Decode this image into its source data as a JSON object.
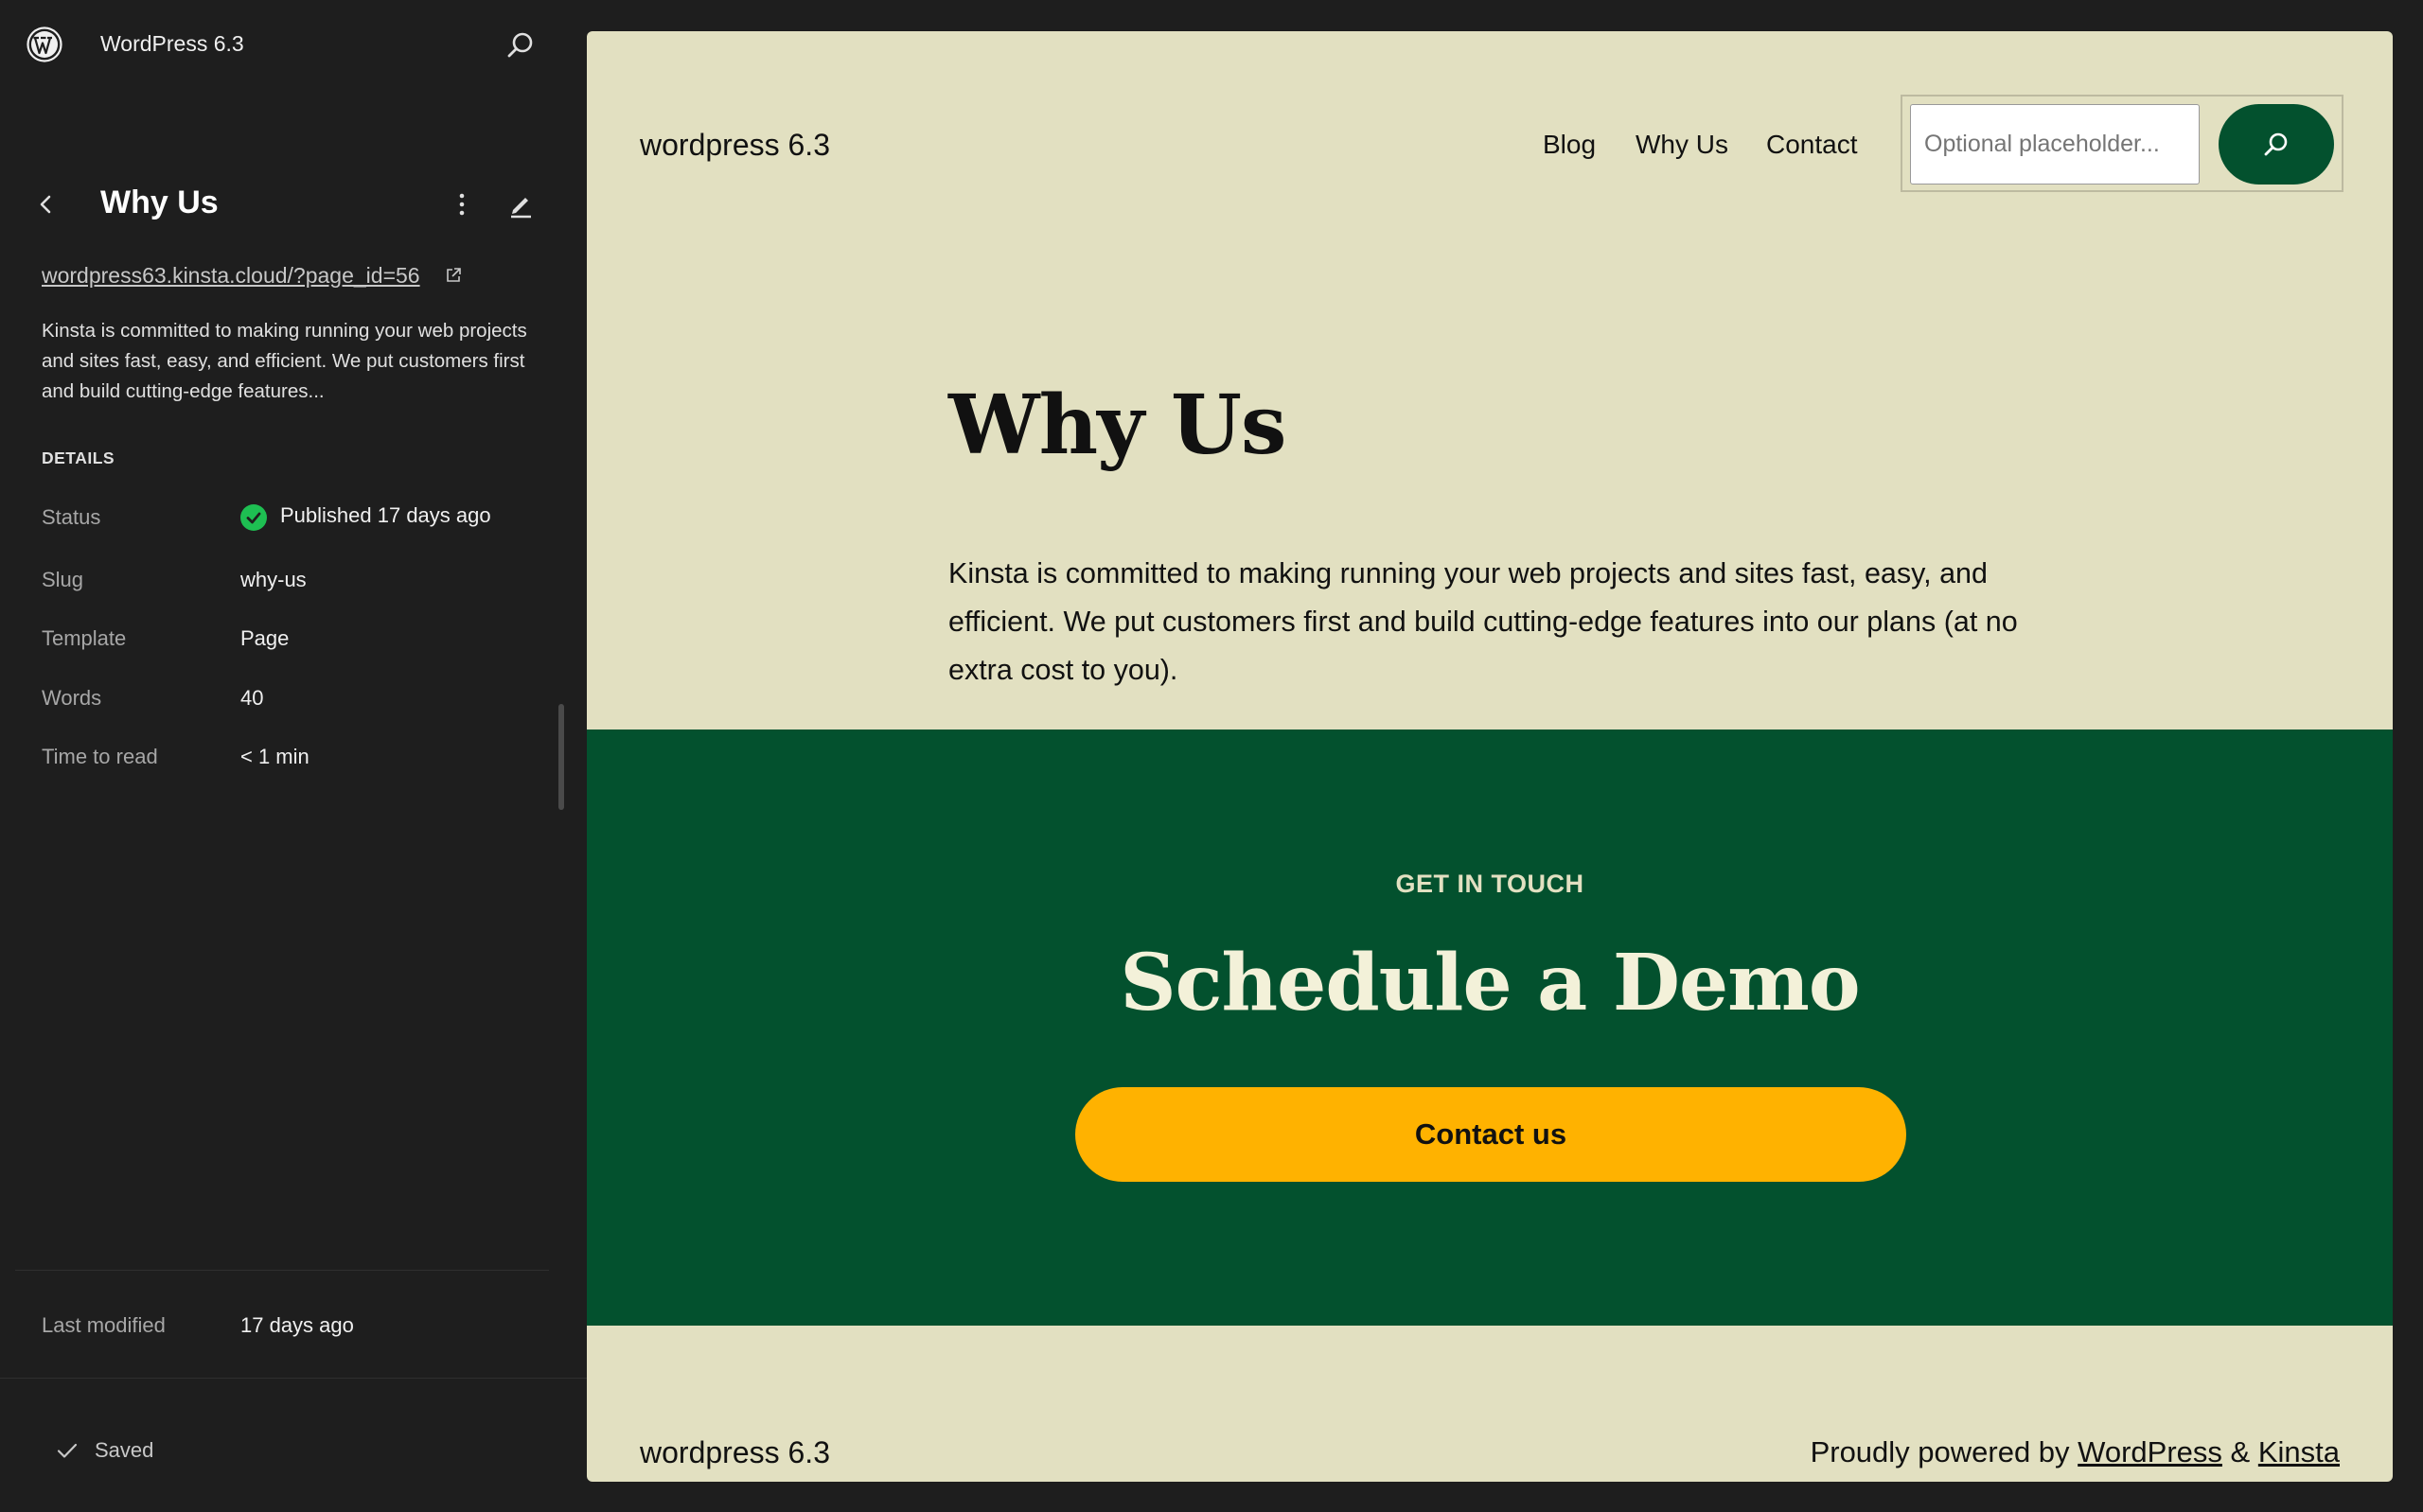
{
  "sidebar": {
    "site_title": "WordPress 6.3",
    "page_title": "Why Us",
    "page_link": "wordpress63.kinsta.cloud/?page_id=56",
    "excerpt": "Kinsta is committed to making running your web projects and sites fast, easy, and efficient. We put customers first and build cutting-edge features...",
    "details_heading": "DETAILS",
    "details": {
      "status_label": "Status",
      "status_value": "Published 17 days ago",
      "slug_label": "Slug",
      "slug_value": "why-us",
      "template_label": "Template",
      "template_value": "Page",
      "words_label": "Words",
      "words_value": "40",
      "time_label": "Time to read",
      "time_value": "< 1 min"
    },
    "last_modified_label": "Last modified",
    "last_modified_value": "17 days ago",
    "saved_label": "Saved"
  },
  "preview": {
    "site_title": "wordpress 6.3",
    "nav": [
      "Blog",
      "Why Us",
      "Contact"
    ],
    "search_placeholder": "Optional placeholder...",
    "heading": "Why Us",
    "body": "Kinsta is committed to making running your web projects and sites fast, easy, and efficient. We put customers first and build cutting-edge features into our plans (at no extra cost to you).",
    "cta_kicker": "GET IN TOUCH",
    "cta_title": "Schedule a Demo",
    "cta_button": "Contact us",
    "footer_site": "wordpress 6.3",
    "footer_powered_prefix": "Proudly powered by ",
    "footer_link_wordpress": "WordPress",
    "footer_amp": " & ",
    "footer_link_kinsta": "Kinsta"
  },
  "colors": {
    "sidebar_bg": "#1e1e1e",
    "preview_bg": "#e2e0c1",
    "cta_bg": "#03512e",
    "cta_button": "#ffb200",
    "status_green": "#1ebf52"
  },
  "icons": {
    "logo": "wordpress-logo-icon",
    "search": "search-icon",
    "back": "chevron-left-icon",
    "more": "more-vertical-icon",
    "edit": "pencil-icon",
    "external": "external-link-icon",
    "status": "check-circle-icon",
    "saved": "check-icon"
  }
}
